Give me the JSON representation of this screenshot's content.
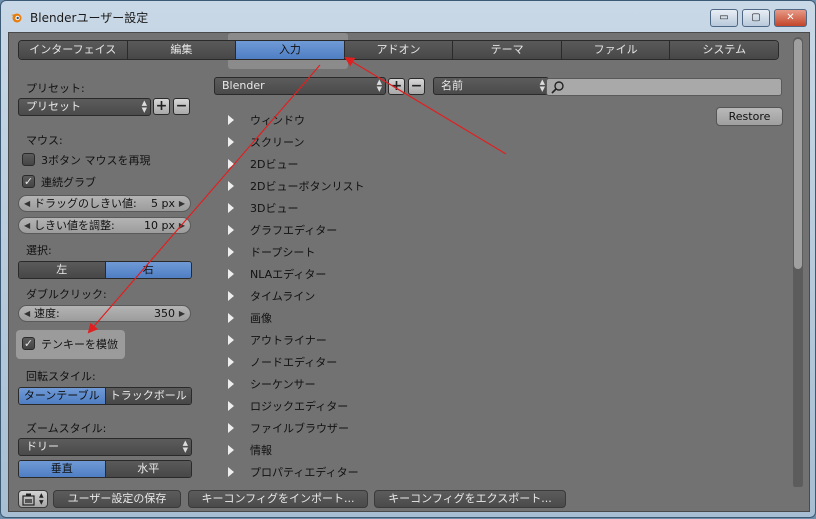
{
  "window": {
    "title": "Blenderユーザー設定",
    "minimize": "▭",
    "maximize": "▢",
    "close": "✕"
  },
  "tabs": [
    {
      "label": "インターフェイス",
      "active": false
    },
    {
      "label": "編集",
      "active": false
    },
    {
      "label": "入力",
      "active": true
    },
    {
      "label": "アドオン",
      "active": false
    },
    {
      "label": "テーマ",
      "active": false
    },
    {
      "label": "ファイル",
      "active": false
    },
    {
      "label": "システム",
      "active": false
    }
  ],
  "left": {
    "preset_label": "プリセット:",
    "preset_value": "プリセット",
    "mouse_label": "マウス:",
    "emulate_3button": {
      "label": "3ボタン マウスを再現",
      "checked": false
    },
    "continuous_grab": {
      "label": "連続グラブ",
      "checked": true
    },
    "drag_threshold": {
      "label": "ドラッグのしきい値:",
      "value": "5 px"
    },
    "tweak_threshold": {
      "label": "しきい値を調整:",
      "value": "10 px"
    },
    "select_label": "選択:",
    "select_left": "左",
    "select_right": "右",
    "double_click_label": "ダブルクリック:",
    "speed": {
      "label": "速度:",
      "value": "350"
    },
    "emulate_numpad": {
      "label": "テンキーを模倣",
      "checked": true
    },
    "orbit_style_label": "回転スタイル:",
    "orbit_turntable": "ターンテーブル",
    "orbit_trackball": "トラックボール",
    "zoom_style_label": "ズームスタイル:",
    "zoom_style_value": "ドリー",
    "zoom_vertical": "垂直",
    "zoom_horizontal": "水平"
  },
  "right": {
    "keymap_preset": "Blender",
    "filter_type": "名前",
    "search_value": "",
    "restore_label": "Restore",
    "keymap_items": [
      "ウィンドウ",
      "スクリーン",
      "2Dビュー",
      "2Dビューボタンリスト",
      "3Dビュー",
      "グラフエディター",
      "ドープシート",
      "NLAエディター",
      "タイムライン",
      "画像",
      "アウトライナー",
      "ノードエディター",
      "シーケンサー",
      "ロジックエディター",
      "ファイルブラウザー",
      "情報",
      "プロパティエディター"
    ]
  },
  "footer": {
    "save_prefs": "ユーザー設定の保存",
    "import_keyconfig": "キーコンフィグをインポート...",
    "export_keyconfig": "キーコンフィグをエクスポート..."
  },
  "colors": {
    "accent_blue": "#5b88ca",
    "annotation_red": "#e02020",
    "panel_gray": "#727272"
  }
}
